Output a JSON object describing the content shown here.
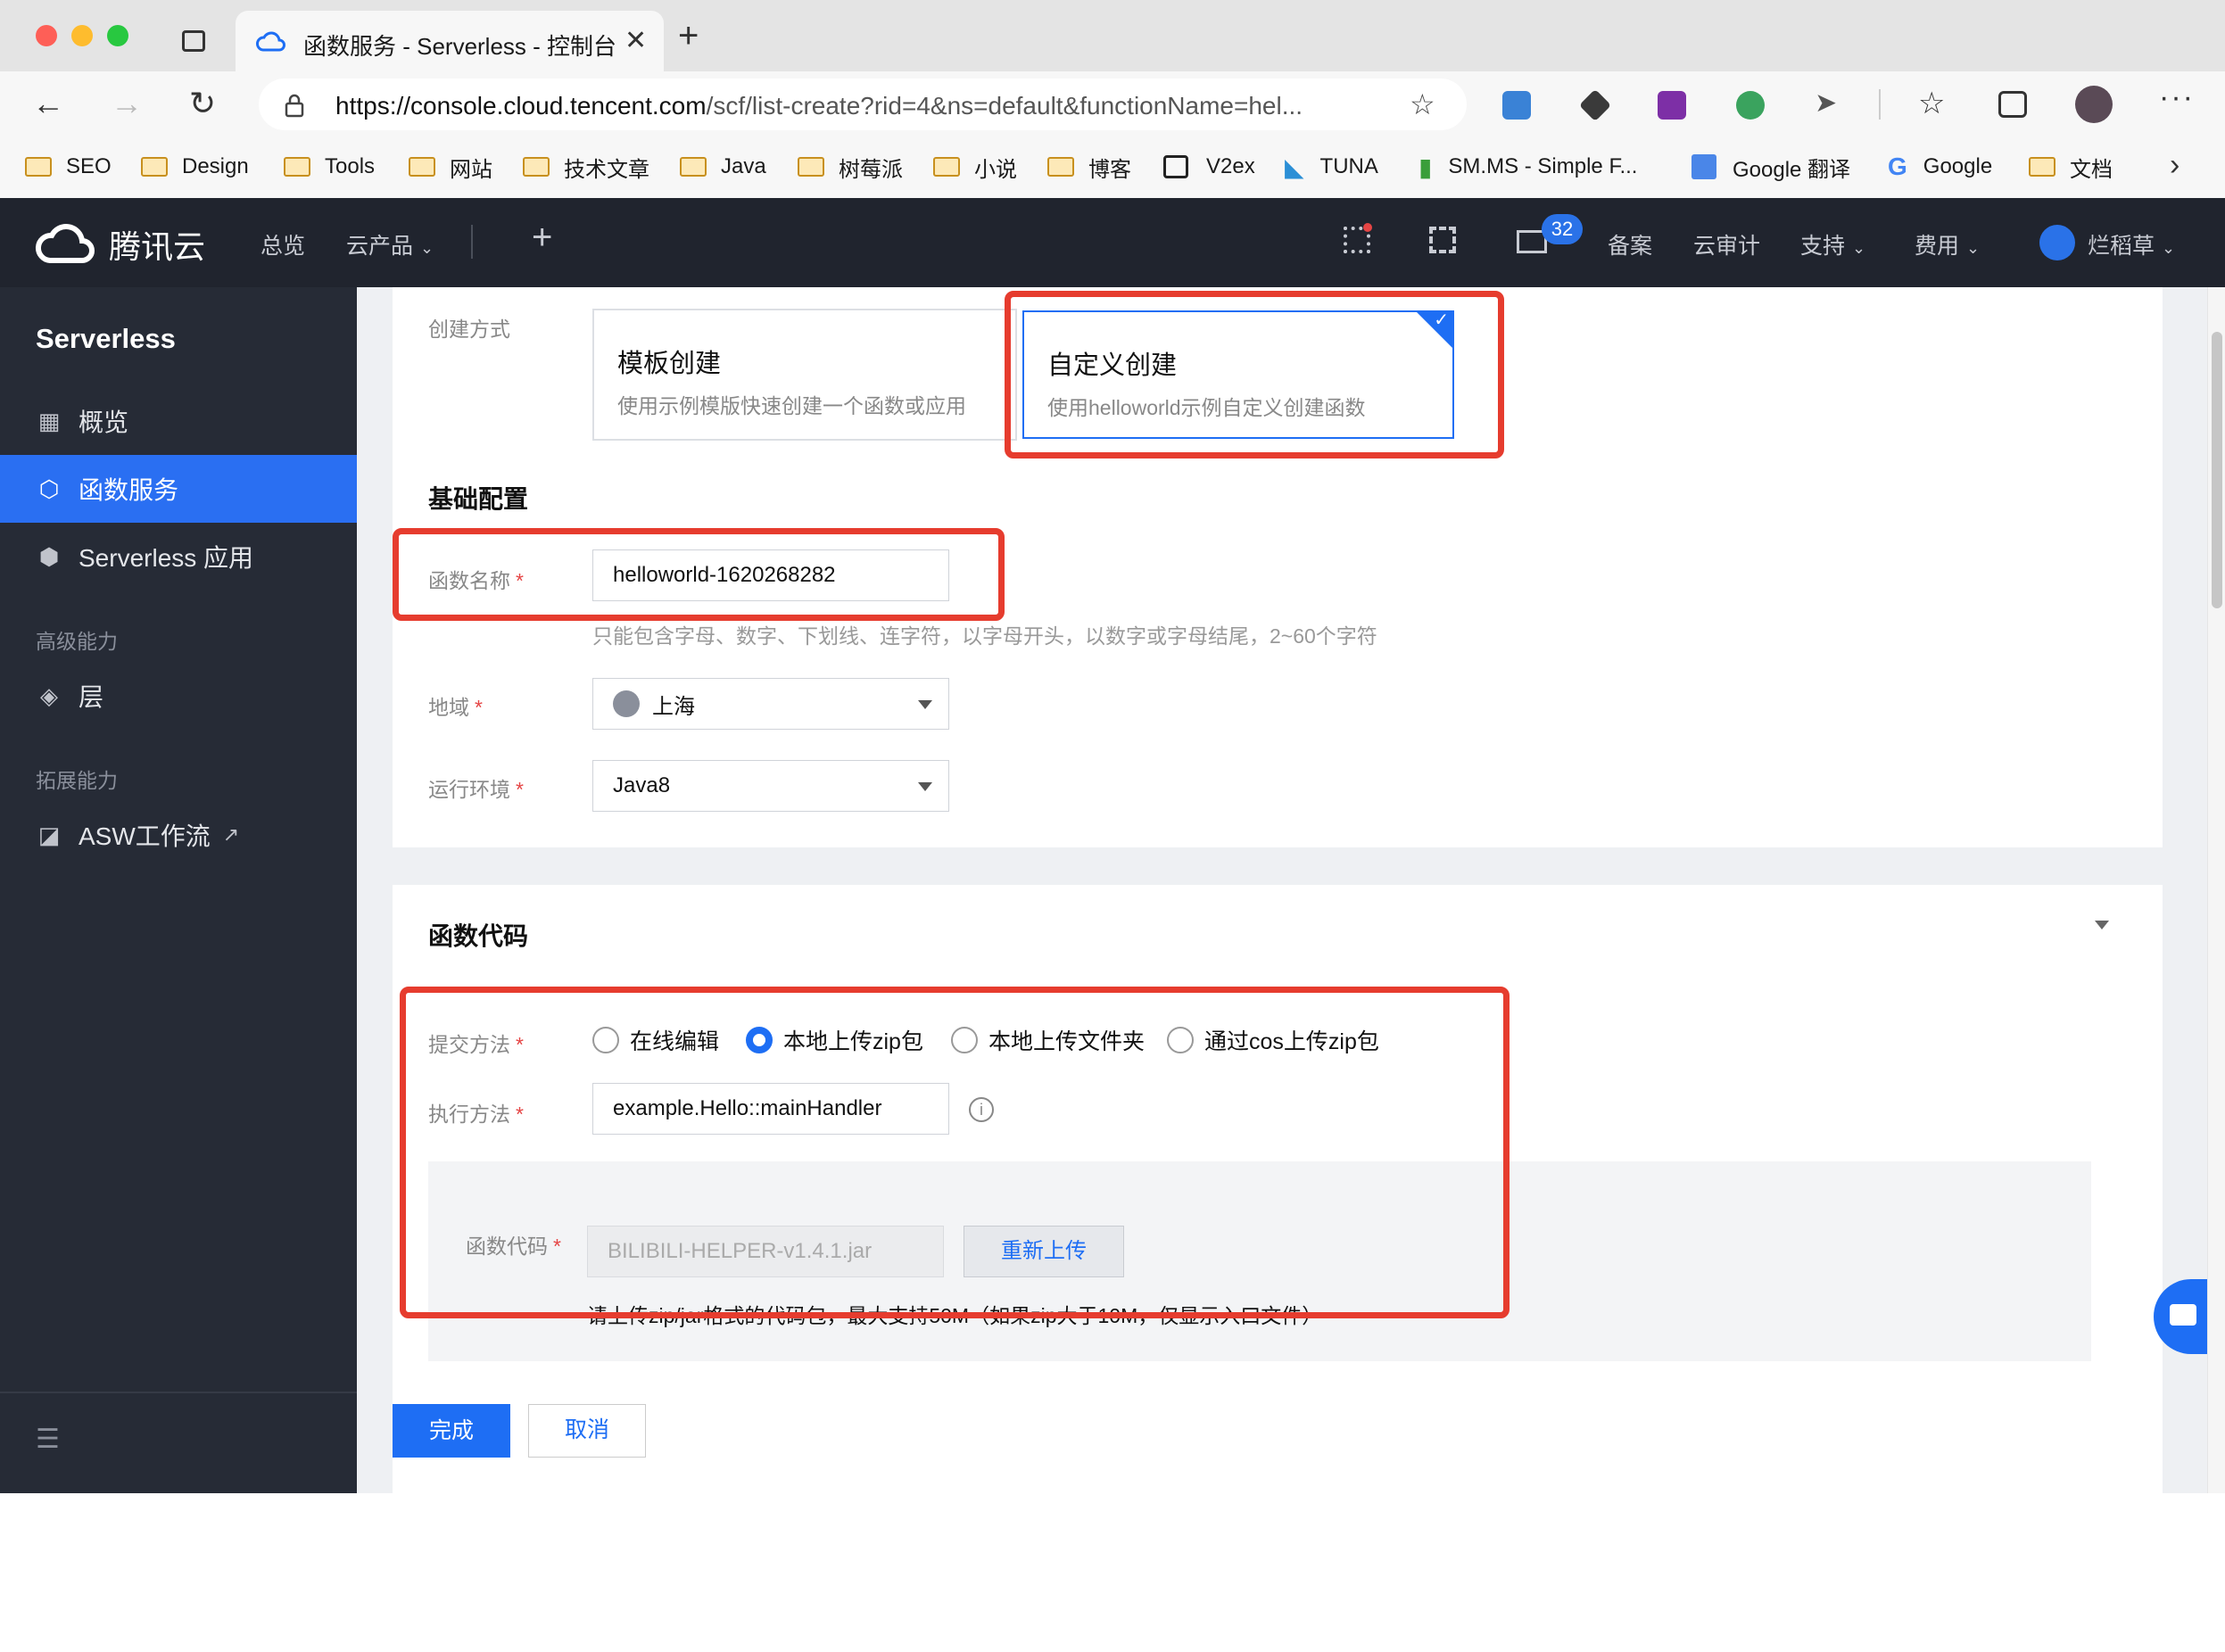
{
  "browser": {
    "tab_title": "函数服务 - Serverless - 控制台",
    "url_host": "https://console.cloud.tencent.com",
    "url_path": "/scf/list-create?rid=4&ns=default&functionName=hel...",
    "bookmarks": [
      "SEO",
      "Design",
      "Tools",
      "网站",
      "技术文章",
      "Java",
      "树莓派",
      "小说",
      "博客",
      "V2ex",
      "TUNA",
      "SM.MS - Simple F...",
      "Google 翻译",
      "Google",
      "文档"
    ]
  },
  "header": {
    "brand": "腾讯云",
    "nav": [
      "总览",
      "云产品"
    ],
    "badge_count": "32",
    "right_links": [
      "备案",
      "云审计",
      "支持",
      "费用"
    ],
    "user": "烂稻草"
  },
  "sidebar": {
    "title": "Serverless",
    "items": [
      "概览",
      "函数服务",
      "Serverless 应用"
    ],
    "group_advanced": "高级能力",
    "layer": "层",
    "group_ext": "拓展能力",
    "asw": "ASW工作流"
  },
  "form": {
    "create_method_label": "创建方式",
    "template": {
      "title": "模板创建",
      "desc": "使用示例模版快速创建一个函数或应用"
    },
    "custom": {
      "title": "自定义创建",
      "desc": "使用helloworld示例自定义创建函数"
    },
    "basic_title": "基础配置",
    "fn_name_label": "函数名称",
    "fn_name_value": "helloworld-1620268282",
    "fn_name_hint": "只能包含字母、数字、下划线、连字符，以字母开头，以数字或字母结尾，2~60个字符",
    "region_label": "地域",
    "region_value": "上海",
    "runtime_label": "运行环境",
    "runtime_value": "Java8",
    "code_title": "函数代码",
    "submit_label": "提交方法",
    "submit_options": [
      "在线编辑",
      "本地上传zip包",
      "本地上传文件夹",
      "通过cos上传zip包"
    ],
    "submit_selected": "本地上传zip包",
    "handler_label": "执行方法",
    "handler_value": "example.Hello::mainHandler",
    "code_label": "函数代码",
    "code_file": "BILIBILI-HELPER-v1.4.1.jar",
    "reupload": "重新上传",
    "code_hint": "请上传zip/jar格式的代码包，最大支持50M（如果zip大于10M，仅显示入口文件）",
    "finish": "完成",
    "cancel": "取消"
  },
  "colors": {
    "accent": "#1e6ef4",
    "highlight": "#e63c2e",
    "header_bg": "#20242e",
    "sidebar_bg": "#262b36"
  }
}
